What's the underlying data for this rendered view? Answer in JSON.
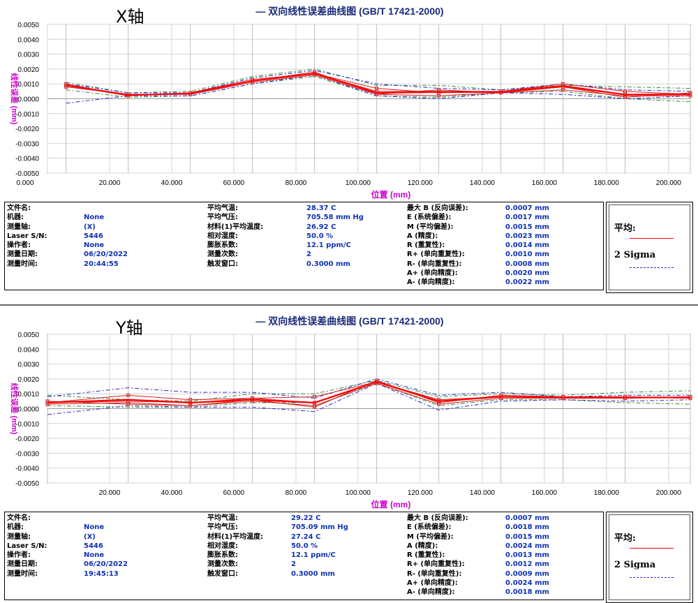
{
  "panels": [
    {
      "axis_name": "X轴",
      "info": {
        "col1_labels": [
          "文件名:",
          "机器:",
          "测量轴:",
          "Laser S/N:",
          "操作者:",
          "测量日期:",
          "测量时间:"
        ],
        "col1_values": [
          "",
          "None",
          "(X)",
          "5446",
          "None",
          "06/20/2022",
          "20:44:55"
        ],
        "col2_labels": [
          "平均气温:",
          "平均气压:",
          "材料(1)平均温度:",
          "相对湿度:",
          "膨胀系数:",
          "测量次数:",
          "触发窗口:"
        ],
        "col2_values": [
          "28.37 C",
          "705.58 mm Hg",
          "26.92 C",
          "50.0 %",
          "12.1 ppm/C",
          "2",
          "0.3000 mm"
        ],
        "col3_labels": [
          "最大 B (反向误差):",
          "E (系统偏差):",
          "M (平均偏差):",
          "A (精度):",
          "R (重复性):",
          "R+ (单向重复性):",
          "R- (单向重复性):",
          "A+ (单向精度):",
          "A- (单向精度):"
        ],
        "col3_values": [
          "0.0007 mm",
          "0.0017 mm",
          "0.0015 mm",
          "0.0023 mm",
          "0.0014 mm",
          "0.0010 mm",
          "0.0008 mm",
          "0.0020 mm",
          "0.0022 mm"
        ]
      },
      "legend": {
        "avg_label": "平均:",
        "sigma_label": "2 Sigma"
      }
    },
    {
      "axis_name": "Y轴",
      "info": {
        "col1_labels": [
          "文件名:",
          "机器:",
          "测量轴:",
          "Laser S/N:",
          "操作者:",
          "测量日期:",
          "测量时间:"
        ],
        "col1_values": [
          "",
          "None",
          "(X)",
          "5446",
          "None",
          "06/20/2022",
          "19:45:13"
        ],
        "col2_labels": [
          "平均气温:",
          "平均气压:",
          "材料(1)平均温度:",
          "相对湿度:",
          "膨胀系数:",
          "测量次数:",
          "触发窗口:"
        ],
        "col2_values": [
          "29.22 C",
          "705.09 mm Hg",
          "27.24 C",
          "50.0 %",
          "12.1 ppm/C",
          "2",
          "0.3000 mm"
        ],
        "col3_labels": [
          "最大 B (反向误差):",
          "E (系统偏差):",
          "M (平均偏差):",
          "A (精度):",
          "R (重复性):",
          "R+ (单向重复性):",
          "R- (单向重复性):",
          "A+ (单向精度):",
          "A- (单向精度):"
        ],
        "col3_values": [
          "0.0007 mm",
          "0.0018 mm",
          "0.0015 mm",
          "0.0024 mm",
          "0.0013 mm",
          "0.0012 mm",
          "0.0009 mm",
          "0.0024 mm",
          "0.0018 mm"
        ]
      },
      "legend": {
        "avg_label": "平均:",
        "sigma_label": "2 Sigma"
      }
    }
  ],
  "colors": {
    "title": "#1a2a7a",
    "ylabel": "#cc00cc",
    "xlabel": "#cc00cc",
    "run": "#cc2020",
    "average": "#ff0000",
    "sigma_green": "#2e8b3a",
    "sigma_blue": "#2626cc",
    "value_text": "#0f32b4"
  },
  "chart_data": [
    {
      "type": "line",
      "title": "— 双向线性误差曲线图 (GB/T 17421-2000)",
      "xlabel": "位置 (mm)",
      "ylabel": "线性误差 (mm)",
      "xlim": [
        0,
        207
      ],
      "ylim": [
        -0.005,
        0.005
      ],
      "x_ticks": [
        "0.000",
        "20.000",
        "40.000",
        "60.000",
        "80.000",
        "100.000",
        "120.000",
        "140.000",
        "160.000",
        "180.000",
        "200.000"
      ],
      "x_tick_values": [
        0,
        20,
        40,
        60,
        80,
        100,
        120,
        140,
        160,
        180,
        200
      ],
      "y_ticks": [
        "0.0050",
        "0.0040",
        "0.0030",
        "0.0020",
        "0.0010",
        "0.0000",
        "-0.0010",
        "-0.0020",
        "-0.0030",
        "-0.0040",
        "-0.0050"
      ],
      "y_tick_values": [
        0.005,
        0.004,
        0.003,
        0.002,
        0.001,
        0,
        -0.001,
        -0.002,
        -0.003,
        -0.004,
        -0.005
      ],
      "grid": true,
      "x": [
        6,
        26,
        46,
        66,
        86,
        106,
        126,
        146,
        166,
        186,
        207
      ],
      "series": [
        {
          "role": "run",
          "values": [
            0.0009,
            0.0003,
            0.0003,
            0.0012,
            0.0018,
            0.0003,
            0.0006,
            0.0004,
            0.0008,
            0.0001,
            0.0004
          ]
        },
        {
          "role": "run",
          "values": [
            0.001,
            0.0002,
            0.0004,
            0.0013,
            0.0017,
            0.0007,
            0.0004,
            0.0005,
            0.001,
            0.0005,
            0.0003
          ]
        },
        {
          "role": "run",
          "values": [
            0.0008,
            0.0003,
            0.0003,
            0.0011,
            0.0016,
            0.0003,
            0.0002,
            0.0004,
            0.0006,
            0.0002,
            0.0002
          ]
        },
        {
          "role": "run",
          "values": [
            0.0009,
            0.0002,
            0.0004,
            0.0012,
            0.0017,
            0.0005,
            0.0005,
            0.0005,
            0.0009,
            0.0003,
            0.0003
          ]
        },
        {
          "role": "average",
          "values": [
            0.0009,
            0.00025,
            0.00035,
            0.0012,
            0.0017,
            0.0004,
            0.00045,
            0.00045,
            0.00083,
            0.00028,
            0.0003
          ]
        },
        {
          "role": "sigma_upper",
          "values": [
            0.0011,
            0.0004,
            0.0005,
            0.0015,
            0.002,
            0.0009,
            0.0009,
            0.0006,
            0.0009,
            0.0008,
            0.0007
          ]
        },
        {
          "role": "sigma_lower",
          "values": [
            0.0006,
            0.0001,
            0.0002,
            0.001,
            0.0015,
            0.0002,
            0.0001,
            0.0004,
            0.0005,
            0.0,
            -0.0002
          ]
        },
        {
          "role": "sigma_upper_blue",
          "values": [
            0.001,
            0.0004,
            0.0004,
            0.0014,
            0.0019,
            0.001,
            0.0007,
            0.0006,
            0.001,
            0.0006,
            0.0005
          ]
        },
        {
          "role": "sigma_lower_blue",
          "values": [
            -0.0003,
            0.0002,
            0.0002,
            0.001,
            0.0016,
            0.0002,
            0.0,
            0.0004,
            0.0003,
            0.0,
            0.0002
          ]
        }
      ]
    },
    {
      "type": "line",
      "title": "— 双向线性误差曲线图 (GB/T 17421-2000)",
      "xlabel": "位置 (mm)",
      "ylabel": "线性误差 (mm)",
      "xlim": [
        0,
        207
      ],
      "ylim": [
        -0.005,
        0.005
      ],
      "x_ticks": [
        "20.000",
        "40.000",
        "60.000",
        "80.000",
        "100.000",
        "120.000",
        "140.000",
        "160.000",
        "180.000",
        "200.000"
      ],
      "x_tick_values": [
        20,
        40,
        60,
        80,
        100,
        120,
        140,
        160,
        180,
        200
      ],
      "y_ticks": [
        "0.0050",
        "0.0040",
        "0.0030",
        "0.0020",
        "0.0010",
        "0.0000",
        "-0.0010",
        "-0.0020",
        "-0.0030",
        "-0.0040",
        "-0.0050"
      ],
      "y_tick_values": [
        0.005,
        0.004,
        0.003,
        0.002,
        0.001,
        0,
        -0.001,
        -0.002,
        -0.003,
        -0.004,
        -0.005
      ],
      "grid": true,
      "x": [
        0,
        26,
        46,
        66,
        86,
        106,
        126,
        146,
        166,
        186,
        207
      ],
      "series": [
        {
          "role": "run",
          "values": [
            0.0004,
            0.0009,
            0.0006,
            0.0007,
            0.0008,
            0.0018,
            0.0005,
            0.0008,
            0.0007,
            0.0007,
            0.0008
          ]
        },
        {
          "role": "run",
          "values": [
            0.0005,
            0.0003,
            0.0002,
            0.0006,
            0.0001,
            0.0019,
            0.0004,
            0.0009,
            0.0008,
            0.0008,
            0.0007
          ]
        },
        {
          "role": "run",
          "values": [
            0.0003,
            0.0004,
            0.0002,
            0.0005,
            0.0002,
            0.0017,
            0.0003,
            0.0007,
            0.0007,
            0.0008,
            0.0007
          ]
        },
        {
          "role": "run",
          "values": [
            0.0004,
            0.0005,
            0.0004,
            0.0007,
            0.0004,
            0.0018,
            0.0006,
            0.0008,
            0.0008,
            0.0007,
            0.0008
          ]
        },
        {
          "role": "average",
          "values": [
            0.0004,
            0.0006,
            0.0004,
            0.0006,
            0.0004,
            0.0018,
            0.0005,
            0.0008,
            0.00075,
            0.00075,
            0.00075
          ]
        },
        {
          "role": "sigma_upper",
          "values": [
            0.0009,
            0.0006,
            0.0005,
            0.001,
            0.001,
            0.0019,
            0.0008,
            0.001,
            0.0009,
            0.0011,
            0.0012
          ]
        },
        {
          "role": "sigma_lower",
          "values": [
            0.0002,
            0.0001,
            0.0001,
            0.0004,
            0.0004,
            0.0017,
            0.0002,
            0.0006,
            0.0006,
            0.0004,
            0.0003
          ]
        },
        {
          "role": "sigma_upper_blue",
          "values": [
            0.0008,
            0.0014,
            0.0011,
            0.0011,
            0.0007,
            0.002,
            0.0009,
            0.0011,
            0.0008,
            0.0009,
            0.0009
          ]
        },
        {
          "role": "sigma_lower_blue",
          "values": [
            -0.0004,
            0.0002,
            0.0001,
            0.0001,
            -0.0002,
            0.0017,
            -0.0001,
            0.0005,
            0.0006,
            0.0005,
            0.0006
          ]
        }
      ]
    }
  ]
}
